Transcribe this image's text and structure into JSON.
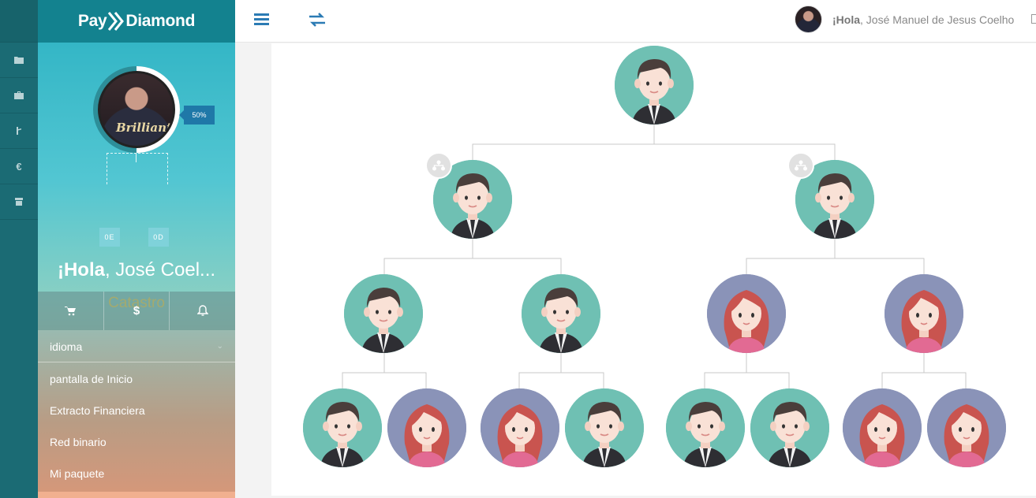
{
  "brand": {
    "name_left": "Pay",
    "name_right": "Diamond"
  },
  "rail": {
    "items": [
      {
        "icon": "folder-icon"
      },
      {
        "icon": "briefcase-icon"
      },
      {
        "icon": "currency-p-icon"
      },
      {
        "icon": "euro-icon",
        "glyph": "€"
      },
      {
        "icon": "archive-icon"
      }
    ]
  },
  "profile": {
    "progress_label": "50%",
    "progress": 0.5,
    "avatar_caption": "Brilliant",
    "left_count": "0E",
    "right_count": "0D",
    "greeting_bold": "¡Hola",
    "greeting_rest": ", José Coel...",
    "role": "Catastro"
  },
  "quick": {
    "cart": "cart-icon",
    "dollar": "$",
    "bell": "bell-icon"
  },
  "menu": {
    "idioma": "idioma",
    "items": [
      "pantalla de Inicio",
      "Extracto Financiera",
      "Red binario",
      "Mi paquete"
    ]
  },
  "topbar": {
    "greeting_bold": "¡Hola",
    "greeting_rest": ", José Manuel de Jesus Coelho"
  },
  "tree": {
    "nodes": [
      {
        "id": "root",
        "gender": "male"
      },
      {
        "id": "l",
        "gender": "male",
        "has_subtree_button": true
      },
      {
        "id": "r",
        "gender": "male",
        "has_subtree_button": true
      },
      {
        "id": "ll",
        "gender": "male"
      },
      {
        "id": "lr",
        "gender": "male"
      },
      {
        "id": "rl",
        "gender": "female"
      },
      {
        "id": "rr",
        "gender": "female"
      },
      {
        "id": "lll",
        "gender": "male"
      },
      {
        "id": "llr",
        "gender": "female"
      },
      {
        "id": "lrl",
        "gender": "female"
      },
      {
        "id": "lrr",
        "gender": "male"
      },
      {
        "id": "rll",
        "gender": "male"
      },
      {
        "id": "rlr",
        "gender": "male"
      },
      {
        "id": "rrl",
        "gender": "female"
      },
      {
        "id": "rrr",
        "gender": "female"
      }
    ]
  },
  "colors": {
    "teal": "#13828f",
    "accent": "#1f78a8",
    "role": "#f6c84d",
    "male_bg": "#6fc0b3",
    "female_bg": "#8a93b8"
  }
}
